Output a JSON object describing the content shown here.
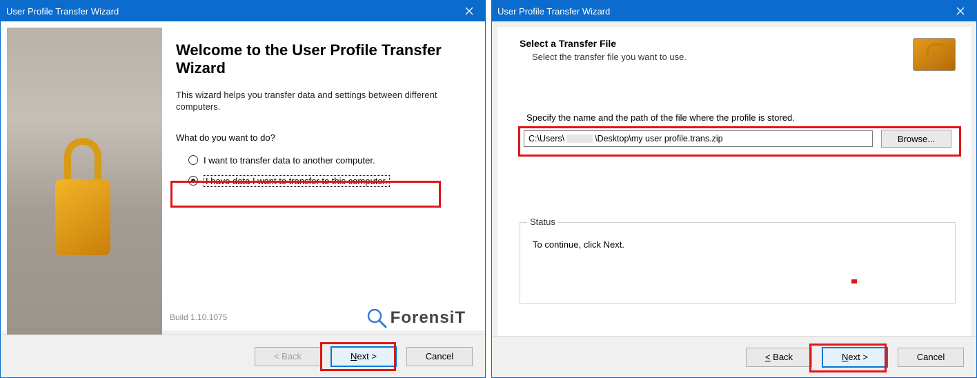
{
  "window1": {
    "title": "User Profile Transfer Wizard",
    "heading": "Welcome to the User Profile Transfer Wizard",
    "intro": "This wizard helps you transfer data and settings between different computers.",
    "question": "What do you want to do?",
    "radio1": "I want to transfer data to another computer.",
    "radio2": "I have data I want to transfer to this computer.",
    "build": "Build 1.10.1075",
    "brand": "ForensiT",
    "back": "< Back",
    "next": "Next >",
    "cancel": "Cancel"
  },
  "window2": {
    "title": "User Profile Transfer Wizard",
    "header": "Select a Transfer File",
    "sub": "Select the transfer file you want to use.",
    "label": "Specify the name and the path of the file where the profile is stored.",
    "path_prefix": "C:\\Users\\",
    "path_suffix": "\\Desktop\\my user profile.trans.zip",
    "browse": "Browse...",
    "status_legend": "Status",
    "status_text": "To continue, click Next.",
    "back": "< Back",
    "next": "Next >",
    "cancel": "Cancel"
  }
}
